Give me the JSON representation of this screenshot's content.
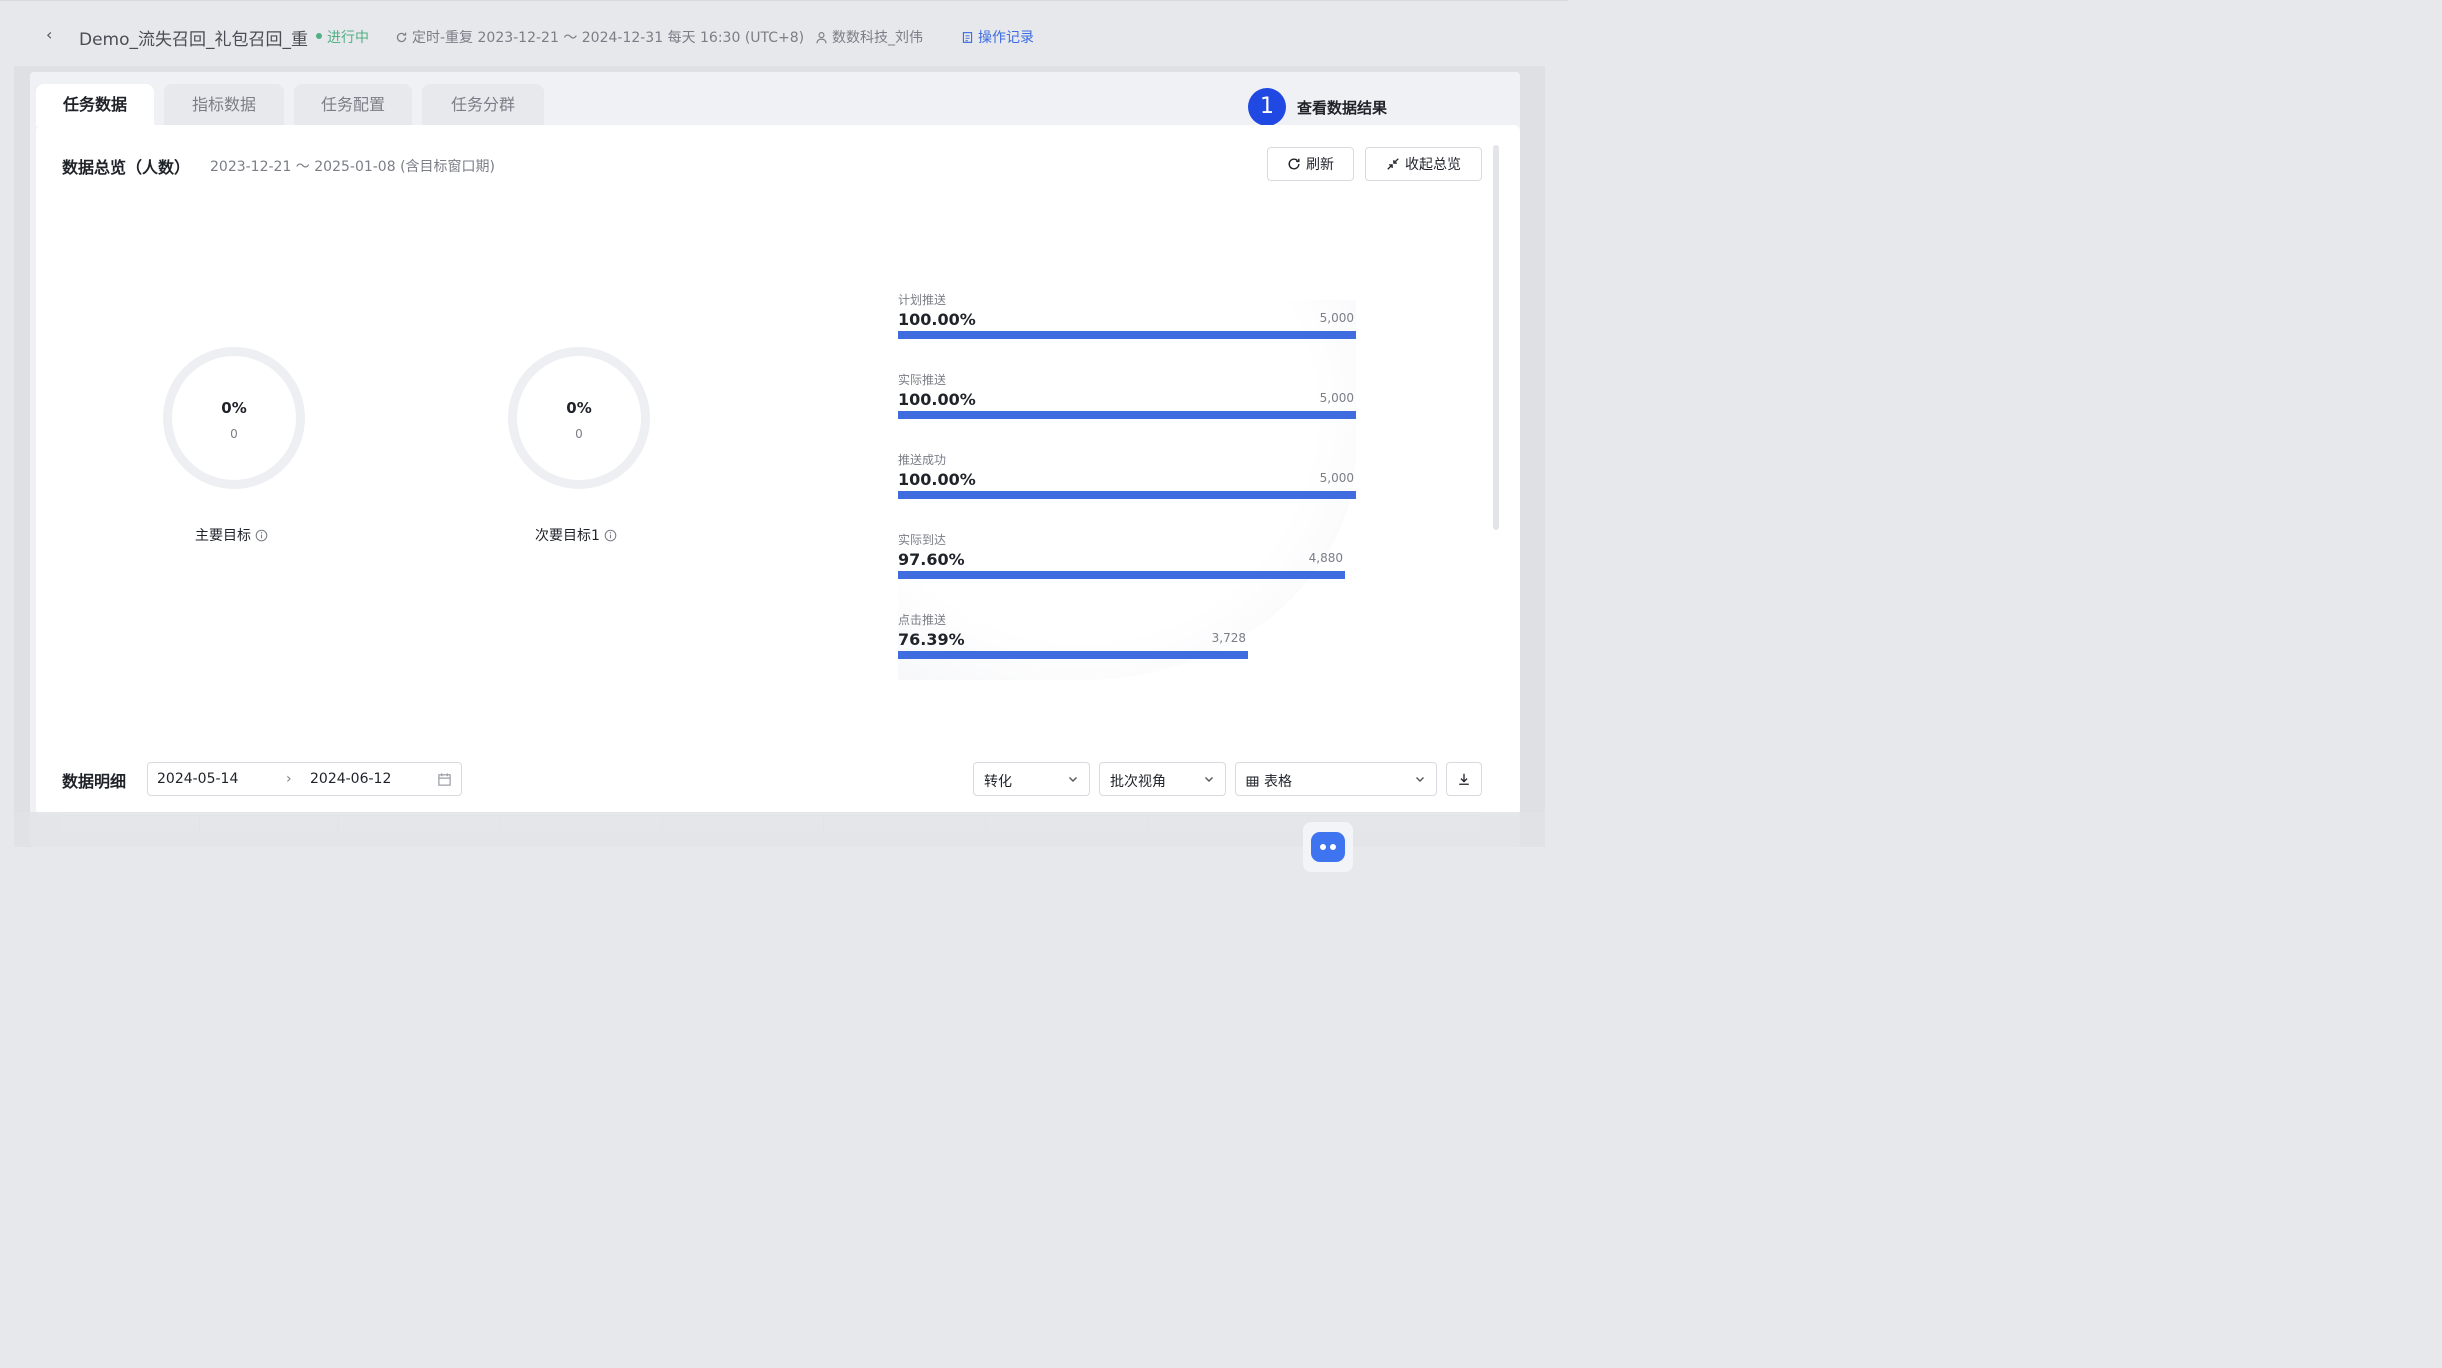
{
  "header": {
    "back_icon": "‹",
    "title": "Demo_流失召回_礼包召回_重",
    "status": "进行中",
    "schedule": "定时-重复  2023-12-21 ～ 2024-12-31 每天 16:30 (UTC+8)",
    "owner": "数数科技_刘伟",
    "oplog": "操作记录"
  },
  "tabs": [
    {
      "label": "任务数据",
      "active": true
    },
    {
      "label": "指标数据",
      "active": false
    },
    {
      "label": "任务配置",
      "active": false
    },
    {
      "label": "任务分群",
      "active": false
    }
  ],
  "step": {
    "number": "1",
    "text": "查看数据结果"
  },
  "overview": {
    "title": "数据总览（人数）",
    "range": "2023-12-21 ～ 2025-01-08 (含目标窗口期)",
    "refresh_label": "刷新",
    "collapse_label": "收起总览"
  },
  "goals": [
    {
      "pct": "0%",
      "count": "0",
      "label": "主要目标"
    },
    {
      "pct": "0%",
      "count": "0",
      "label": "次要目标1"
    }
  ],
  "funnel": [
    {
      "label": "计划推送",
      "pct": "100.00%",
      "count": "5,000",
      "ratio": 1.0
    },
    {
      "label": "实际推送",
      "pct": "100.00%",
      "count": "5,000",
      "ratio": 1.0
    },
    {
      "label": "推送成功",
      "pct": "100.00%",
      "count": "5,000",
      "ratio": 1.0
    },
    {
      "label": "实际到达",
      "pct": "97.60%",
      "count": "4,880",
      "ratio": 0.976
    },
    {
      "label": "点击推送",
      "pct": "76.39%",
      "count": "3,728",
      "ratio": 0.7639
    }
  ],
  "detail": {
    "title": "数据明细",
    "start_date": "2024-05-14",
    "end_date": "2024-06-12",
    "metric_select": "转化",
    "view_select": "批次视角",
    "display_select": "表格"
  },
  "colors": {
    "accent": "#3f6de0",
    "status": "#52b085",
    "badge": "#2049e3"
  }
}
